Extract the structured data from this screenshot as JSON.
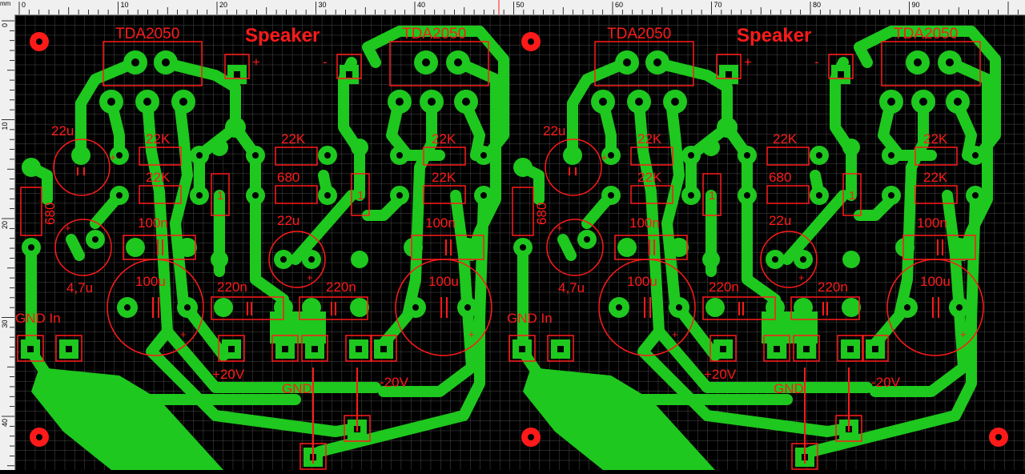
{
  "ruler": {
    "unit": "mm",
    "h_ticks": [
      "0",
      "10",
      "20",
      "30",
      "40",
      "50",
      "60",
      "70",
      "80",
      "90"
    ],
    "v_ticks": [
      "0",
      "10",
      "20",
      "30",
      "40"
    ]
  },
  "channel": {
    "chip_left": "TDA2050",
    "chip_right": "TDA2050",
    "speaker": "Speaker",
    "sp_plus": "+",
    "sp_minus": "-",
    "cap_22u_a": "22u",
    "cap_22u_b": "22u",
    "res_22k_a": "22K",
    "res_22k_b": "22K",
    "res_22k_c": "22K",
    "res_22k_d": "22K",
    "res_22k_e": "22K",
    "res_680_a": "680",
    "res_680_b": "680",
    "res_1_a": "1",
    "res_1_b": "1",
    "cap_100n_a": "100n",
    "cap_100n_b": "100n",
    "cap_47u": "4,7u",
    "cap_100u_a": "100u",
    "cap_100u_b": "100u",
    "cap_220n_a": "220n",
    "cap_220n_b": "220n",
    "gnd_in": "GND In",
    "v_pos": "+20V",
    "gnd": "GND",
    "v_neg": "-20V",
    "plus": "+"
  },
  "colors": {
    "copper": "#1ec81e",
    "silk": "#ff1a1a",
    "grid": "#4a4a4a",
    "background": "#000000"
  }
}
